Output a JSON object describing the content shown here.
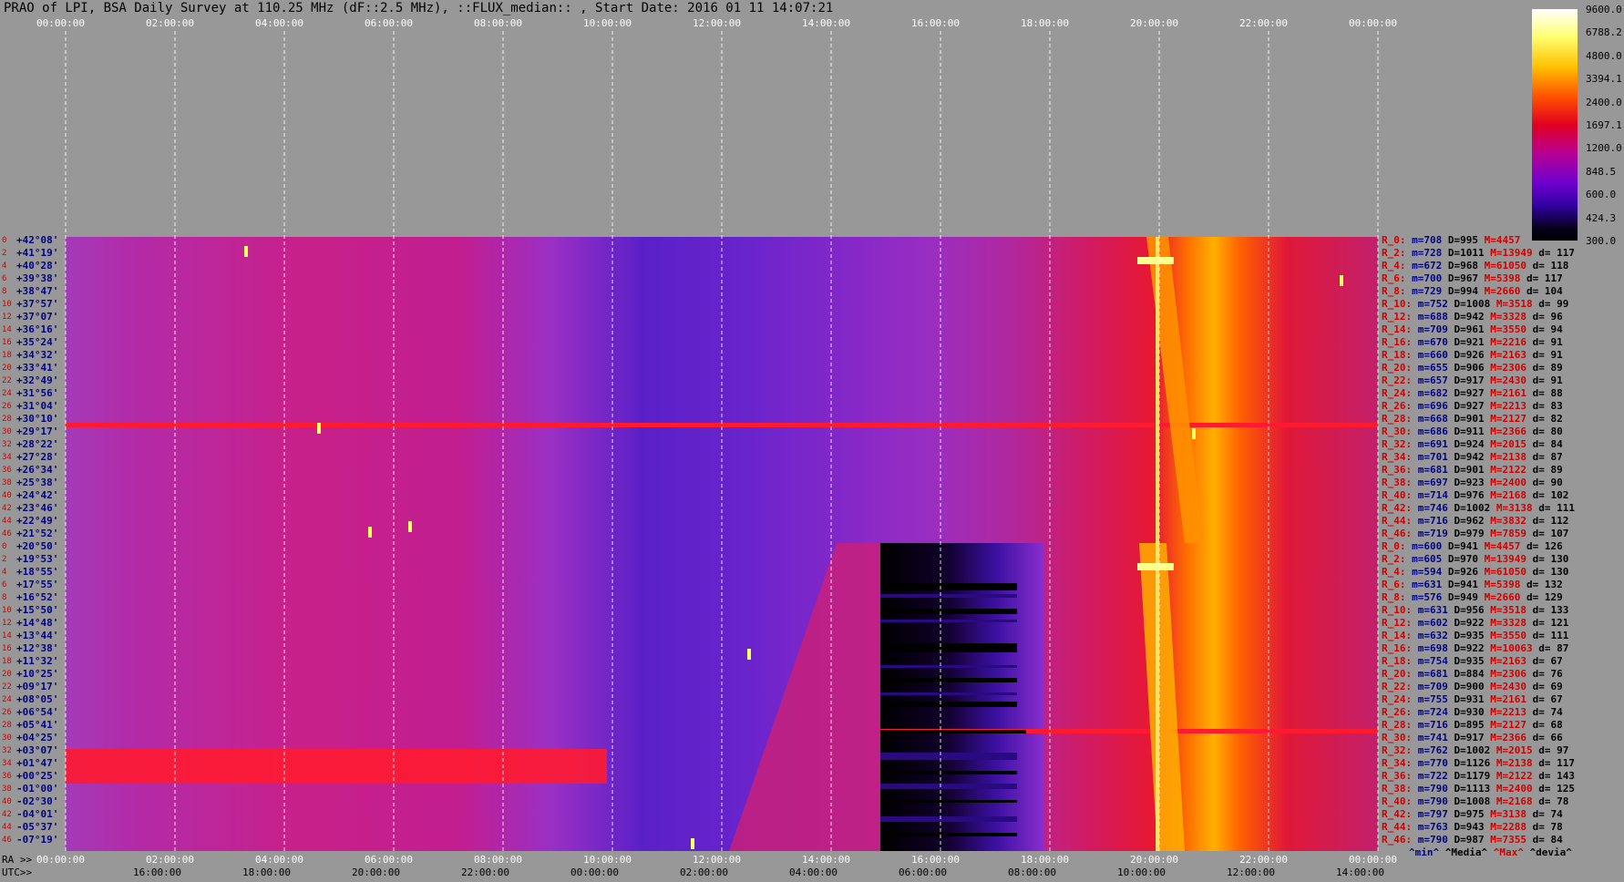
{
  "title": "PRAO of LPI, BSA Daily Survey at 110.25 MHz (dF::2.5 MHz), ::FLUX_median:: , Start Date: 2016 01 11 14:07:21",
  "top_axis_ticks": [
    "00:00:00",
    "02:00:00",
    "04:00:00",
    "06:00:00",
    "08:00:00",
    "10:00:00",
    "12:00:00",
    "14:00:00",
    "16:00:00",
    "18:00:00",
    "20:00:00",
    "22:00:00",
    "00:00:00"
  ],
  "bottom_axis": {
    "ra_label": "RA >>",
    "utc_label": "UTC>>",
    "ra_ticks": [
      "00:00:00",
      "02:00:00",
      "04:00:00",
      "06:00:00",
      "08:00:00",
      "10:00:00",
      "12:00:00",
      "14:00:00",
      "16:00:00",
      "18:00:00",
      "20:00:00",
      "22:00:00",
      "00:00:00"
    ],
    "utc_ticks": [
      "16:00:00",
      "18:00:00",
      "20:00:00",
      "22:00:00",
      "00:00:00",
      "02:00:00",
      "04:00:00",
      "06:00:00",
      "08:00:00",
      "10:00:00",
      "12:00:00",
      "14:00:00"
    ]
  },
  "colorbar": {
    "labels": [
      "9600.0",
      "6788.2",
      "4800.0",
      "3394.1",
      "2400.0",
      "1697.1",
      "1200.0",
      "848.5",
      "600.0",
      "424.3",
      "300.0"
    ],
    "colors": [
      "#ffffff",
      "#ffff80",
      "#ffd000",
      "#ff8000",
      "#ff2000",
      "#e00030",
      "#c00080",
      "#9000c0",
      "#5000d0",
      "#100040",
      "#000000"
    ]
  },
  "footer_legend": [
    {
      "text": "^min^",
      "color": "#000080"
    },
    {
      "text": "^Media^",
      "color": "#000000"
    },
    {
      "text": "^Max^",
      "color": "#d00000"
    },
    {
      "text": "^devia^",
      "color": "#000000"
    }
  ],
  "chart_data": {
    "type": "heatmap",
    "title": "PRAO of LPI, BSA Daily Survey at 110.25 MHz (dF::2.5 MHz), ::FLUX_median:: , Start Date: 2016 01 11 14:07:21",
    "x_axis": "RA / UTC time",
    "colorscale_range": [
      300.0,
      9600.0
    ],
    "upper_block": {
      "rows": [
        {
          "i": "0",
          "dec": "+42°08'"
        },
        {
          "i": "2",
          "dec": "+41°19'"
        },
        {
          "i": "4",
          "dec": "+40°28'"
        },
        {
          "i": "6",
          "dec": "+39°38'"
        },
        {
          "i": "8",
          "dec": "+38°47'"
        },
        {
          "i": "10",
          "dec": "+37°57'"
        },
        {
          "i": "12",
          "dec": "+37°07'"
        },
        {
          "i": "14",
          "dec": "+36°16'"
        },
        {
          "i": "16",
          "dec": "+35°24'"
        },
        {
          "i": "18",
          "dec": "+34°32'"
        },
        {
          "i": "20",
          "dec": "+33°41'"
        },
        {
          "i": "22",
          "dec": "+32°49'"
        },
        {
          "i": "24",
          "dec": "+31°56'"
        },
        {
          "i": "26",
          "dec": "+31°04'"
        },
        {
          "i": "28",
          "dec": "+30°10'"
        },
        {
          "i": "30",
          "dec": "+29°17'"
        },
        {
          "i": "32",
          "dec": "+28°22'"
        },
        {
          "i": "34",
          "dec": "+27°28'"
        },
        {
          "i": "36",
          "dec": "+26°34'"
        },
        {
          "i": "38",
          "dec": "+25°38'"
        },
        {
          "i": "40",
          "dec": "+24°42'"
        },
        {
          "i": "42",
          "dec": "+23°46'"
        },
        {
          "i": "44",
          "dec": "+22°49'"
        },
        {
          "i": "46",
          "dec": "+21°52'"
        }
      ],
      "stats": [
        {
          "r": "R_0:",
          "m": "m=708",
          "D": "D=995",
          "M": "M=4457",
          "d": ""
        },
        {
          "r": "R_2:",
          "m": "m=728",
          "D": "D=1011",
          "M": "M=13949",
          "d": "d= 117"
        },
        {
          "r": "R_4:",
          "m": "m=672",
          "D": "D=968",
          "M": "M=61050",
          "d": "d= 118"
        },
        {
          "r": "R_6:",
          "m": "m=700",
          "D": "D=967",
          "M": "M=5398",
          "d": "d= 117"
        },
        {
          "r": "R_8:",
          "m": "m=729",
          "D": "D=994",
          "M": "M=2660",
          "d": "d= 104"
        },
        {
          "r": "R_10:",
          "m": "m=752",
          "D": "D=1008",
          "M": "M=3518",
          "d": "d= 99"
        },
        {
          "r": "R_12:",
          "m": "m=688",
          "D": "D=942",
          "M": "M=3328",
          "d": "d= 96"
        },
        {
          "r": "R_14:",
          "m": "m=709",
          "D": "D=961",
          "M": "M=3550",
          "d": "d= 94"
        },
        {
          "r": "R_16:",
          "m": "m=670",
          "D": "D=921",
          "M": "M=2216",
          "d": "d= 91"
        },
        {
          "r": "R_18:",
          "m": "m=660",
          "D": "D=926",
          "M": "M=2163",
          "d": "d= 91"
        },
        {
          "r": "R_20:",
          "m": "m=655",
          "D": "D=906",
          "M": "M=2306",
          "d": "d= 89"
        },
        {
          "r": "R_22:",
          "m": "m=657",
          "D": "D=917",
          "M": "M=2430",
          "d": "d= 91"
        },
        {
          "r": "R_24:",
          "m": "m=682",
          "D": "D=927",
          "M": "M=2161",
          "d": "d= 88"
        },
        {
          "r": "R_26:",
          "m": "m=696",
          "D": "D=927",
          "M": "M=2213",
          "d": "d= 83"
        },
        {
          "r": "R_28:",
          "m": "m=668",
          "D": "D=901",
          "M": "M=2127",
          "d": "d= 82"
        },
        {
          "r": "R_30:",
          "m": "m=686",
          "D": "D=911",
          "M": "M=2366",
          "d": "d= 80"
        },
        {
          "r": "R_32:",
          "m": "m=691",
          "D": "D=924",
          "M": "M=2015",
          "d": "d= 84"
        },
        {
          "r": "R_34:",
          "m": "m=701",
          "D": "D=942",
          "M": "M=2138",
          "d": "d= 87"
        },
        {
          "r": "R_36:",
          "m": "m=681",
          "D": "D=901",
          "M": "M=2122",
          "d": "d= 89"
        },
        {
          "r": "R_38:",
          "m": "m=697",
          "D": "D=923",
          "M": "M=2400",
          "d": "d= 90"
        },
        {
          "r": "R_40:",
          "m": "m=714",
          "D": "D=976",
          "M": "M=2168",
          "d": "d= 102"
        },
        {
          "r": "R_42:",
          "m": "m=746",
          "D": "D=1002",
          "M": "M=3138",
          "d": "d= 111"
        },
        {
          "r": "R_44:",
          "m": "m=716",
          "D": "D=962",
          "M": "M=3832",
          "d": "d= 112"
        },
        {
          "r": "R_46:",
          "m": "m=719",
          "D": "D=979",
          "M": "M=7859",
          "d": "d= 107"
        }
      ]
    },
    "lower_block": {
      "rows": [
        {
          "i": "0",
          "dec": "+20°50'"
        },
        {
          "i": "2",
          "dec": "+19°53'"
        },
        {
          "i": "4",
          "dec": "+18°55'"
        },
        {
          "i": "6",
          "dec": "+17°55'"
        },
        {
          "i": "8",
          "dec": "+16°52'"
        },
        {
          "i": "10",
          "dec": "+15°50'"
        },
        {
          "i": "12",
          "dec": "+14°48'"
        },
        {
          "i": "14",
          "dec": "+13°44'"
        },
        {
          "i": "16",
          "dec": "+12°38'"
        },
        {
          "i": "18",
          "dec": "+11°32'"
        },
        {
          "i": "20",
          "dec": "+10°25'"
        },
        {
          "i": "22",
          "dec": "+09°17'"
        },
        {
          "i": "24",
          "dec": "+08°05'"
        },
        {
          "i": "26",
          "dec": "+06°54'"
        },
        {
          "i": "28",
          "dec": "+05°41'"
        },
        {
          "i": "30",
          "dec": "+04°25'"
        },
        {
          "i": "32",
          "dec": "+03°07'"
        },
        {
          "i": "34",
          "dec": "+01°47'"
        },
        {
          "i": "36",
          "dec": "+00°25'"
        },
        {
          "i": "38",
          "dec": "-01°00'"
        },
        {
          "i": "40",
          "dec": "-02°30'"
        },
        {
          "i": "42",
          "dec": "-04°01'"
        },
        {
          "i": "44",
          "dec": "-05°37'"
        },
        {
          "i": "46",
          "dec": "-07°19'"
        }
      ],
      "stats": [
        {
          "r": "R_0:",
          "m": "m=600",
          "D": "D=941",
          "M": "M=4457",
          "d": "d= 126"
        },
        {
          "r": "R_2:",
          "m": "m=605",
          "D": "D=970",
          "M": "M=13949",
          "d": "d= 130"
        },
        {
          "r": "R_4:",
          "m": "m=594",
          "D": "D=926",
          "M": "M=61050",
          "d": "d= 130"
        },
        {
          "r": "R_6:",
          "m": "m=631",
          "D": "D=941",
          "M": "M=5398",
          "d": "d= 132"
        },
        {
          "r": "R_8:",
          "m": "m=576",
          "D": "D=949",
          "M": "M=2660",
          "d": "d= 129"
        },
        {
          "r": "R_10:",
          "m": "m=631",
          "D": "D=956",
          "M": "M=3518",
          "d": "d= 133"
        },
        {
          "r": "R_12:",
          "m": "m=602",
          "D": "D=922",
          "M": "M=3328",
          "d": "d= 121"
        },
        {
          "r": "R_14:",
          "m": "m=632",
          "D": "D=935",
          "M": "M=3550",
          "d": "d= 111"
        },
        {
          "r": "R_16:",
          "m": "m=698",
          "D": "D=922",
          "M": "M=10063",
          "d": "d= 87"
        },
        {
          "r": "R_18:",
          "m": "m=754",
          "D": "D=935",
          "M": "M=2163",
          "d": "d= 67"
        },
        {
          "r": "R_20:",
          "m": "m=681",
          "D": "D=884",
          "M": "M=2306",
          "d": "d= 76"
        },
        {
          "r": "R_22:",
          "m": "m=709",
          "D": "D=900",
          "M": "M=2430",
          "d": "d= 69"
        },
        {
          "r": "R_24:",
          "m": "m=755",
          "D": "D=931",
          "M": "M=2161",
          "d": "d= 67"
        },
        {
          "r": "R_26:",
          "m": "m=724",
          "D": "D=930",
          "M": "M=2213",
          "d": "d= 74"
        },
        {
          "r": "R_28:",
          "m": "m=716",
          "D": "D=895",
          "M": "M=2127",
          "d": "d= 68"
        },
        {
          "r": "R_30:",
          "m": "m=741",
          "D": "D=917",
          "M": "M=2366",
          "d": "d= 66"
        },
        {
          "r": "R_32:",
          "m": "m=762",
          "D": "D=1002",
          "M": "M=2015",
          "d": "d= 97"
        },
        {
          "r": "R_34:",
          "m": "m=770",
          "D": "D=1126",
          "M": "M=2138",
          "d": "d= 117"
        },
        {
          "r": "R_36:",
          "m": "m=722",
          "D": "D=1179",
          "M": "M=2122",
          "d": "d= 143"
        },
        {
          "r": "R_38:",
          "m": "m=790",
          "D": "D=1113",
          "M": "M=2400",
          "d": "d= 125"
        },
        {
          "r": "R_40:",
          "m": "m=790",
          "D": "D=1008",
          "M": "M=2168",
          "d": "d= 78"
        },
        {
          "r": "R_42:",
          "m": "m=797",
          "D": "D=975",
          "M": "M=3138",
          "d": "d= 74"
        },
        {
          "r": "R_44:",
          "m": "m=763",
          "D": "D=943",
          "M": "M=2288",
          "d": "d= 78"
        },
        {
          "r": "R_46:",
          "m": "m=790",
          "D": "D=987",
          "M": "M=7355",
          "d": "d= 84"
        }
      ]
    }
  }
}
